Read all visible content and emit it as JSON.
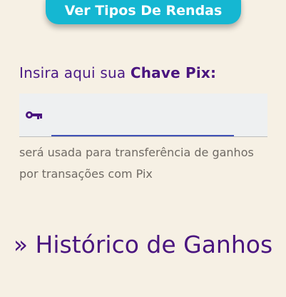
{
  "rendas_button": {
    "label": "Ver Tipos De Rendas"
  },
  "pix": {
    "label_prefix": "Insira aqui sua",
    "label_emphasis": "Chave Pix:",
    "input_value": "",
    "helper_text": "será usada para transferência de ganhos por transações com Pix",
    "icon": "key-icon"
  },
  "history": {
    "title": "» Histórico de Ganhos"
  },
  "colors": {
    "background": "#f6f0e4",
    "button": "#15b7d2",
    "purple": "#4a157f",
    "input_bg": "#eef0f1",
    "input_underline": "#3f51b5"
  }
}
